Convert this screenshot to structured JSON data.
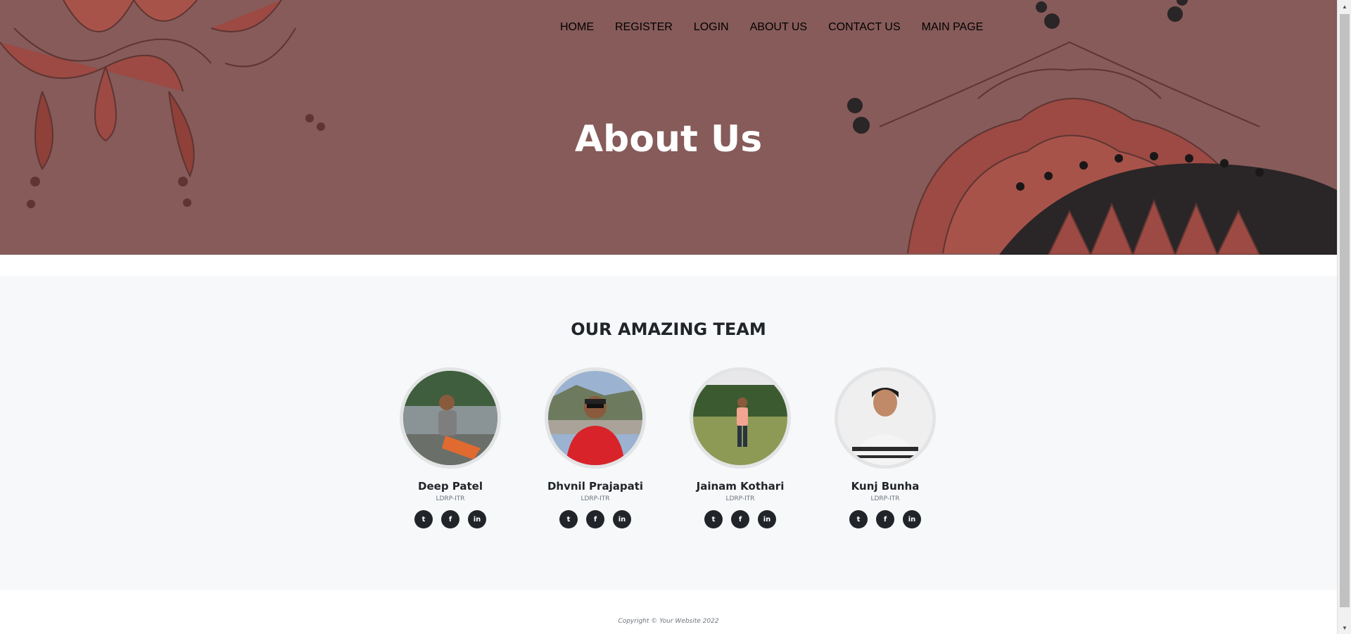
{
  "nav": {
    "items": [
      "HOME",
      "REGISTER",
      "LOGIN",
      "ABOUT US",
      "CONTACT US",
      "MAIN PAGE"
    ]
  },
  "hero": {
    "title": "About Us",
    "background_color": "#865b59"
  },
  "team": {
    "title": "OUR AMAZING TEAM",
    "members": [
      {
        "name": "Deep Patel",
        "role": "LDRP-ITR"
      },
      {
        "name": "Dhvnil Prajapati",
        "role": "LDRP-ITR"
      },
      {
        "name": "Jainam Kothari",
        "role": "LDRP-ITR"
      },
      {
        "name": "Kunj Bunha",
        "role": "LDRP-ITR"
      }
    ],
    "social_icons": [
      "twitter-icon",
      "facebook-icon",
      "linkedin-icon"
    ]
  },
  "footer": {
    "copyright": "Copyright © Your Website 2022"
  }
}
